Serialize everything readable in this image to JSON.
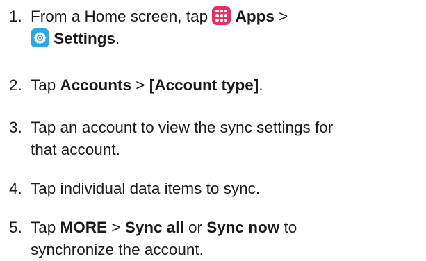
{
  "steps": [
    {
      "number": "1.",
      "line1": {
        "pre": "From a Home screen, tap ",
        "apps_label": "Apps",
        "sep": " >"
      },
      "line2": {
        "settings_label": "Settings",
        "end": "."
      },
      "icons": [
        "apps-icon",
        "settings-icon"
      ]
    },
    {
      "number": "2.",
      "pre": "Tap ",
      "b1": "Accounts",
      "sep": " > ",
      "b2": "[Account type]",
      "end": "."
    },
    {
      "number": "3.",
      "line1": "Tap an account to view the sync settings for",
      "line2": "that account."
    },
    {
      "number": "4.",
      "text": "Tap individual data items to sync."
    },
    {
      "number": "5.",
      "pre": "Tap ",
      "b1": "MORE",
      "sep": " > ",
      "b2": "Sync all",
      "mid": " or ",
      "b3": "Sync now",
      "post": " to",
      "line2": "synchronize the account."
    }
  ],
  "colors": {
    "apps_icon": "#e8315f",
    "settings_icon": "#2aa8e6",
    "text": "#1a1a1a"
  }
}
